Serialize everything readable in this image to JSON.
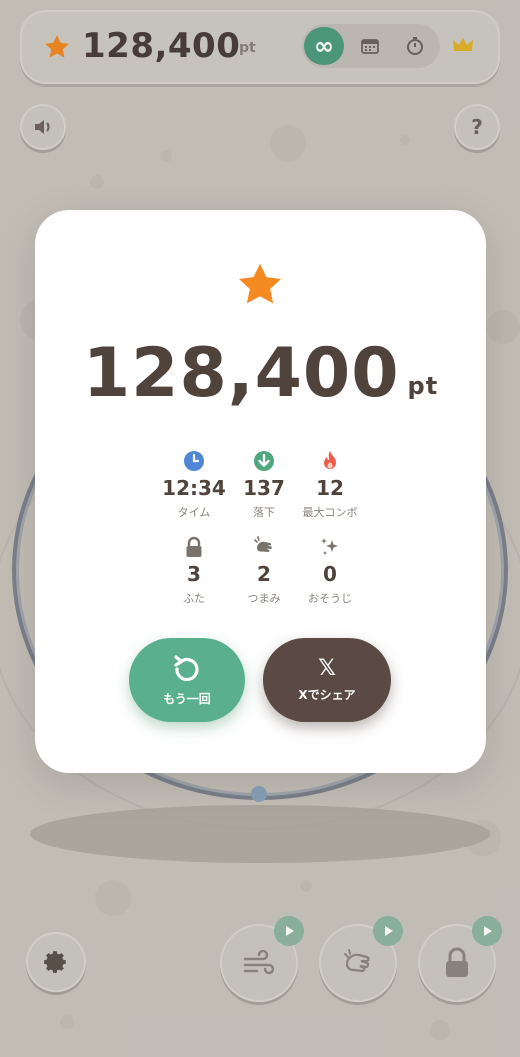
{
  "topbar": {
    "score": "128,400",
    "unit": "pt",
    "modes": [
      {
        "name": "infinite",
        "icon": "infinity-icon",
        "label": "∞",
        "active": true
      },
      {
        "name": "daily",
        "icon": "calendar-icon",
        "active": false
      },
      {
        "name": "time-attack",
        "icon": "stopwatch-icon",
        "active": false
      }
    ],
    "crown_icon": "crown-icon"
  },
  "controls": {
    "sound_icon": "speaker-icon",
    "help_label": "?",
    "settings_icon": "gear-icon",
    "tools": [
      {
        "name": "wind",
        "icon": "wind-icon",
        "badge_icon": "play-icon"
      },
      {
        "name": "pinch",
        "icon": "pinch-hand-icon",
        "badge_icon": "play-icon"
      },
      {
        "name": "lock",
        "icon": "lock-icon",
        "badge_icon": "play-icon"
      }
    ]
  },
  "result": {
    "star_icon": "star-icon",
    "score": "128,400",
    "unit": "pt",
    "stats": [
      {
        "icon": "clock-icon",
        "value": "12:34",
        "label": "タイム"
      },
      {
        "icon": "down-arrow-icon",
        "value": "137",
        "label": "落下"
      },
      {
        "icon": "flame-icon",
        "value": "12",
        "label": "最大コンボ"
      },
      {
        "icon": "lock-icon",
        "value": "3",
        "label": "ふた"
      },
      {
        "icon": "pinch-hand-icon",
        "value": "2",
        "label": "つまみ"
      },
      {
        "icon": "sparkle-icon",
        "value": "0",
        "label": "おそうじ"
      }
    ],
    "retry_label": "もう一回",
    "share_label": "Xでシェア",
    "share_icon": "𝕏"
  },
  "colors": {
    "accent_green": "#5aaf8f",
    "share_brown": "#5a4a43",
    "star_orange": "#f68a22",
    "background": "#c9c5bd"
  }
}
